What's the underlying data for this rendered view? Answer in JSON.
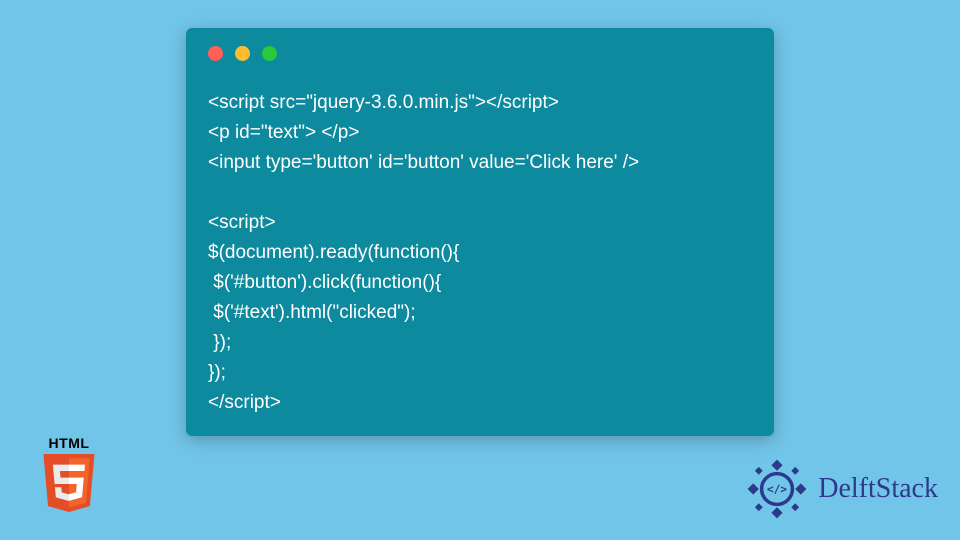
{
  "code": {
    "lines": [
      "<script src=\"jquery-3.6.0.min.js\"></script>",
      "<p id=\"text\"> </p>",
      "<input type='button' id='button' value='Click here' />",
      "",
      "<script>",
      "$(document).ready(function(){",
      " $('#button').click(function(){",
      " $('#text').html(\"clicked\");",
      " });",
      "});",
      "</script>"
    ]
  },
  "html5": {
    "label": "HTML",
    "version": "5"
  },
  "brand": {
    "name": "DelftStack"
  }
}
